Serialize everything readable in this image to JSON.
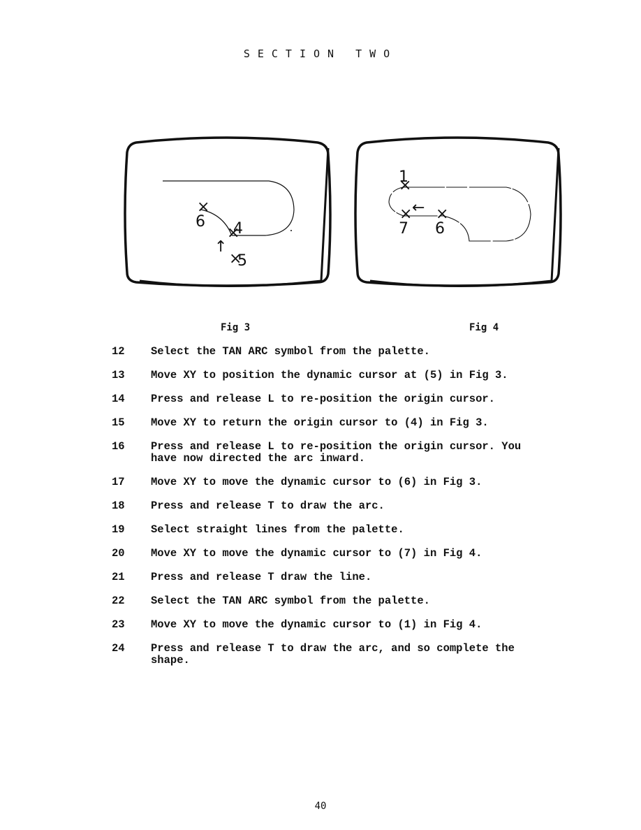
{
  "header": {
    "title": "SECTION TWO"
  },
  "figures": [
    {
      "caption": "Fig 3",
      "labels": {
        "p6": "6",
        "p4": "4",
        "p5": "5",
        "arrow": "↑"
      }
    },
    {
      "caption": "Fig 4",
      "labels": {
        "p1": "1",
        "p7": "7",
        "p6": "6",
        "arrow": "←"
      }
    }
  ],
  "steps": [
    {
      "num": "12",
      "text": "Select the TAN ARC symbol from the palette."
    },
    {
      "num": "13",
      "text": "Move XY to position the dynamic cursor at (5) in Fig 3."
    },
    {
      "num": "14",
      "text": "Press and release L to re-position the origin cursor."
    },
    {
      "num": "15",
      "text": "Move XY to return the origin cursor to (4) in Fig 3."
    },
    {
      "num": "16",
      "text": "Press and release L to re-position the origin cursor. You\nhave now directed the arc inward."
    },
    {
      "num": "17",
      "text": "Move XY to move the dynamic cursor to (6) in Fig 3."
    },
    {
      "num": "18",
      "text": "Press and release T to draw the arc."
    },
    {
      "num": "19",
      "text": "Select straight lines from the palette."
    },
    {
      "num": "20",
      "text": "Move XY to move the dynamic cursor to (7) in Fig 4."
    },
    {
      "num": "21",
      "text": "Press and release T draw the line."
    },
    {
      "num": "22",
      "text": "Select the TAN ARC symbol from the palette."
    },
    {
      "num": "23",
      "text": "Move XY to move the dynamic cursor to (1) in Fig 4."
    },
    {
      "num": "24",
      "text": "Press and release T to draw the arc, and so complete the\nshape."
    }
  ],
  "footer": {
    "page_number": "40"
  }
}
